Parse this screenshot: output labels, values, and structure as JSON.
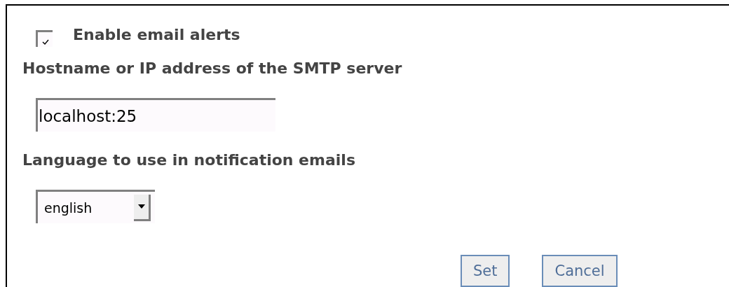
{
  "alerts": {
    "label": "Enable email alerts",
    "checked": true
  },
  "smtp": {
    "label": "Hostname or IP address of the SMTP server",
    "value": "localhost:25"
  },
  "language": {
    "label": "Language to use in notification emails",
    "value": "english"
  },
  "buttons": [
    "Set",
    "Cancel"
  ]
}
